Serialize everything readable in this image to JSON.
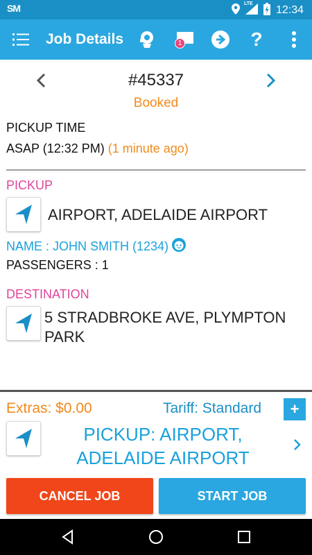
{
  "status_bar": {
    "logo": "SM",
    "network": "LTE",
    "time": "12:34"
  },
  "app_bar": {
    "title": "Job Details",
    "message_badge": "1",
    "icons": [
      "menu-icon",
      "meter-icon",
      "chat-icon",
      "navigation-share-icon",
      "help-icon",
      "more-vert-icon"
    ]
  },
  "job": {
    "number": "#45337",
    "status": "Booked",
    "pickup_time_label": "PICKUP TIME",
    "pickup_time_value": "ASAP (12:32 PM)",
    "pickup_time_relative": "(1 minute ago)",
    "pickup_label": "PICKUP",
    "pickup_address": "AIRPORT, ADELAIDE AIRPORT",
    "name": "NAME : JOHN SMITH (1234)",
    "passengers": "PASSENGERS : 1",
    "destination_label": "DESTINATION",
    "destination_address": "5 STRADBROKE AVE, PLYMPTON PARK"
  },
  "bottom": {
    "extras": "Extras: $0.00",
    "tariff": "Tariff: Standard",
    "plus": "+",
    "next_line1": "PICKUP:  AIRPORT,",
    "next_line2": "ADELAIDE AIRPORT",
    "cancel_label": "CANCEL JOB",
    "start_label": "START JOB"
  },
  "colors": {
    "primary": "#2aa7e0",
    "status_bar": "#1a8fc6",
    "accent_orange": "#f08a1c",
    "accent_pink": "#e0449a",
    "cancel": "#f0461a"
  }
}
